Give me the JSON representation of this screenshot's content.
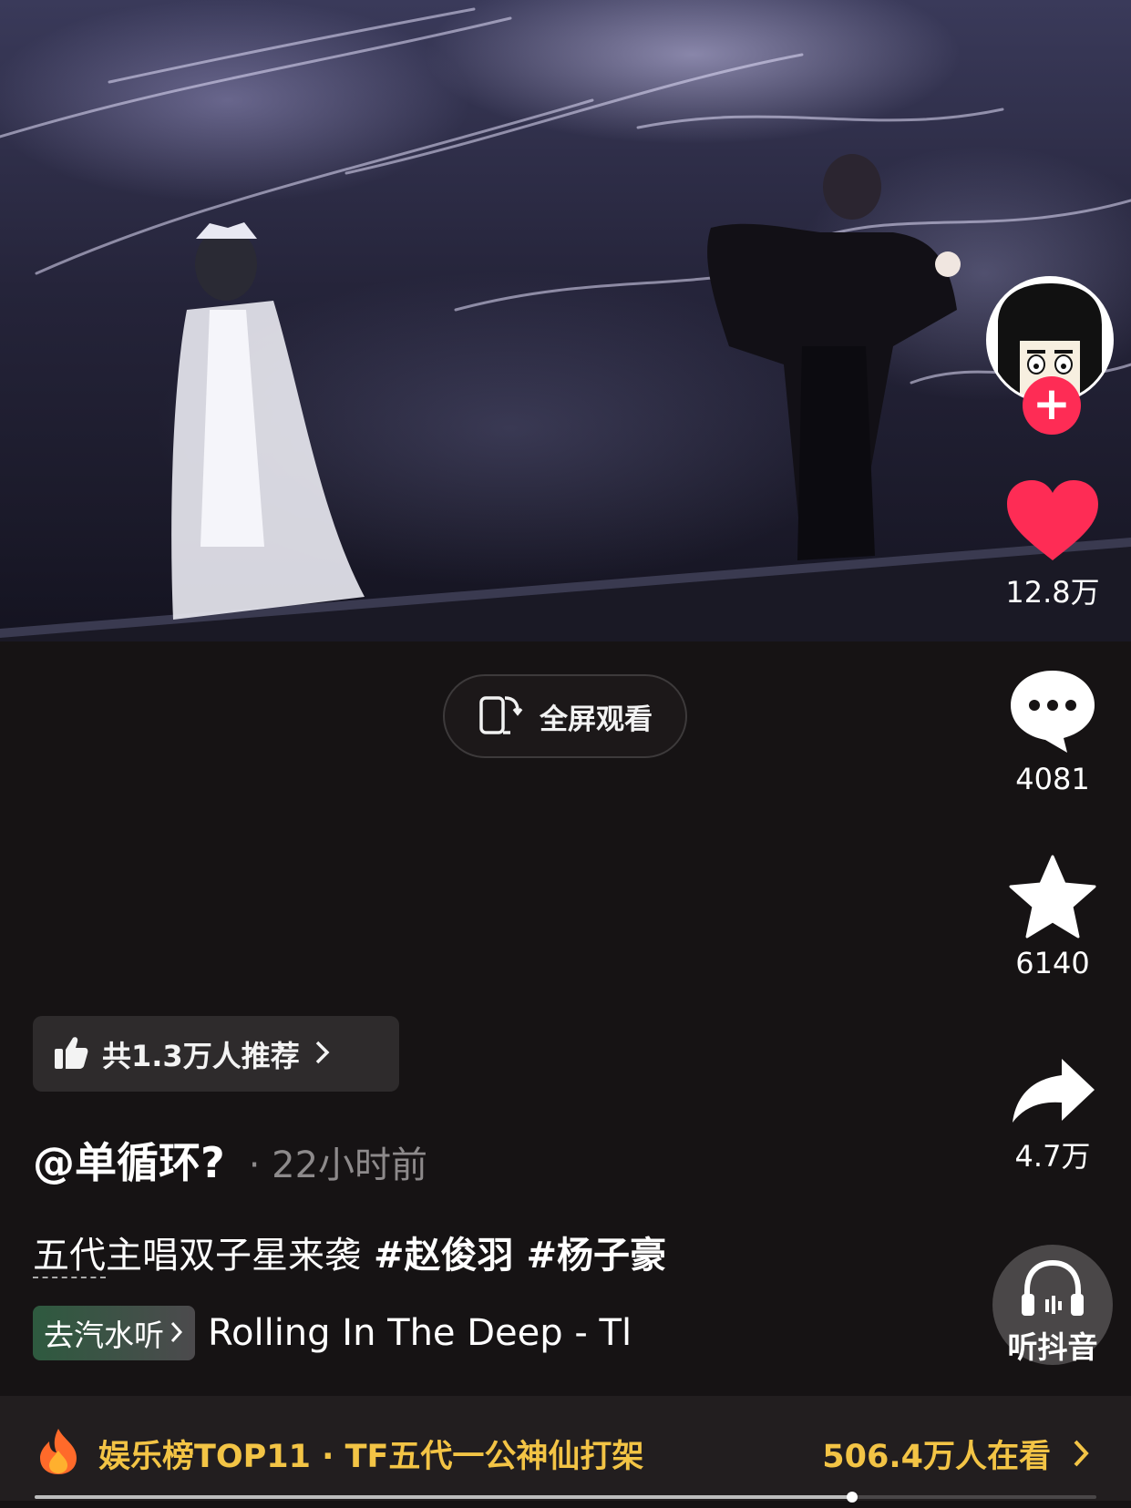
{
  "video": {
    "description_icon": "concert-stage-video"
  },
  "fullscreen": {
    "label": "全屏观看",
    "icon": "rotate-phone-icon"
  },
  "actions": {
    "like_count": "12.8万",
    "comment_count": "4081",
    "favorite_count": "6140",
    "share_count": "4.7万",
    "listen_label": "听抖音"
  },
  "recommend": {
    "label": "共1.3万人推荐"
  },
  "post": {
    "author": "@单循环?",
    "time": "· 22小时前",
    "caption_keyword": "五代",
    "caption_text": "主唱双子星来袭",
    "hashtags": [
      "#赵俊羽",
      "#杨子豪"
    ]
  },
  "music": {
    "badge": "去汽水听",
    "title": "Rolling In The Deep - Tl"
  },
  "hot": {
    "title": "娱乐榜TOP11 · TF五代一公神仙打架",
    "watching": "506.4万人在看"
  },
  "progress": {
    "fraction": 0.77
  },
  "colors": {
    "like": "#fe2c55",
    "hot": "#f3c445",
    "follow": "#fe2c55"
  }
}
